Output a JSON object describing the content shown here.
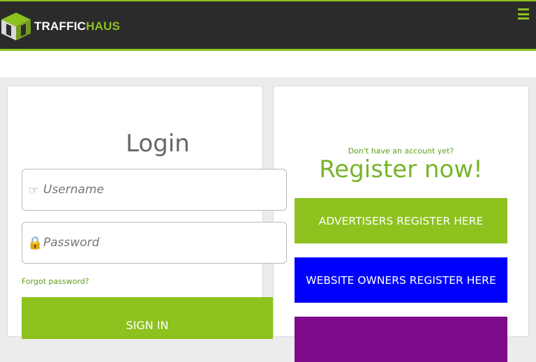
{
  "header": {
    "logo_text_white": "TRAFFIC",
    "logo_text_green": "HAUS",
    "logo_icon": "traffichaus-cube-logo",
    "menu_icon": "hamburger-menu-icon",
    "accent_color": "#8dc21f",
    "bar_color": "#2b2b2b"
  },
  "login": {
    "title": "Login",
    "username_placeholder": "Username",
    "username_icon": "pointing-hand-icon",
    "username_glyph": "☞",
    "password_placeholder": "Password",
    "password_icon": "lock-icon",
    "password_glyph": "🔒",
    "forgot_label": "Forgot password?",
    "signin_label": "SIGN IN"
  },
  "register": {
    "prompt": "Don't have an account yet?",
    "title": "Register now!",
    "advertisers_label": "ADVERTISERS REGISTER HERE",
    "website_owners_label": "WEBSITE OWNERS REGISTER HERE",
    "advertisers_color": "#8dc21f",
    "website_owners_color": "#0000ff",
    "third_button_color": "#7d0a8c"
  }
}
